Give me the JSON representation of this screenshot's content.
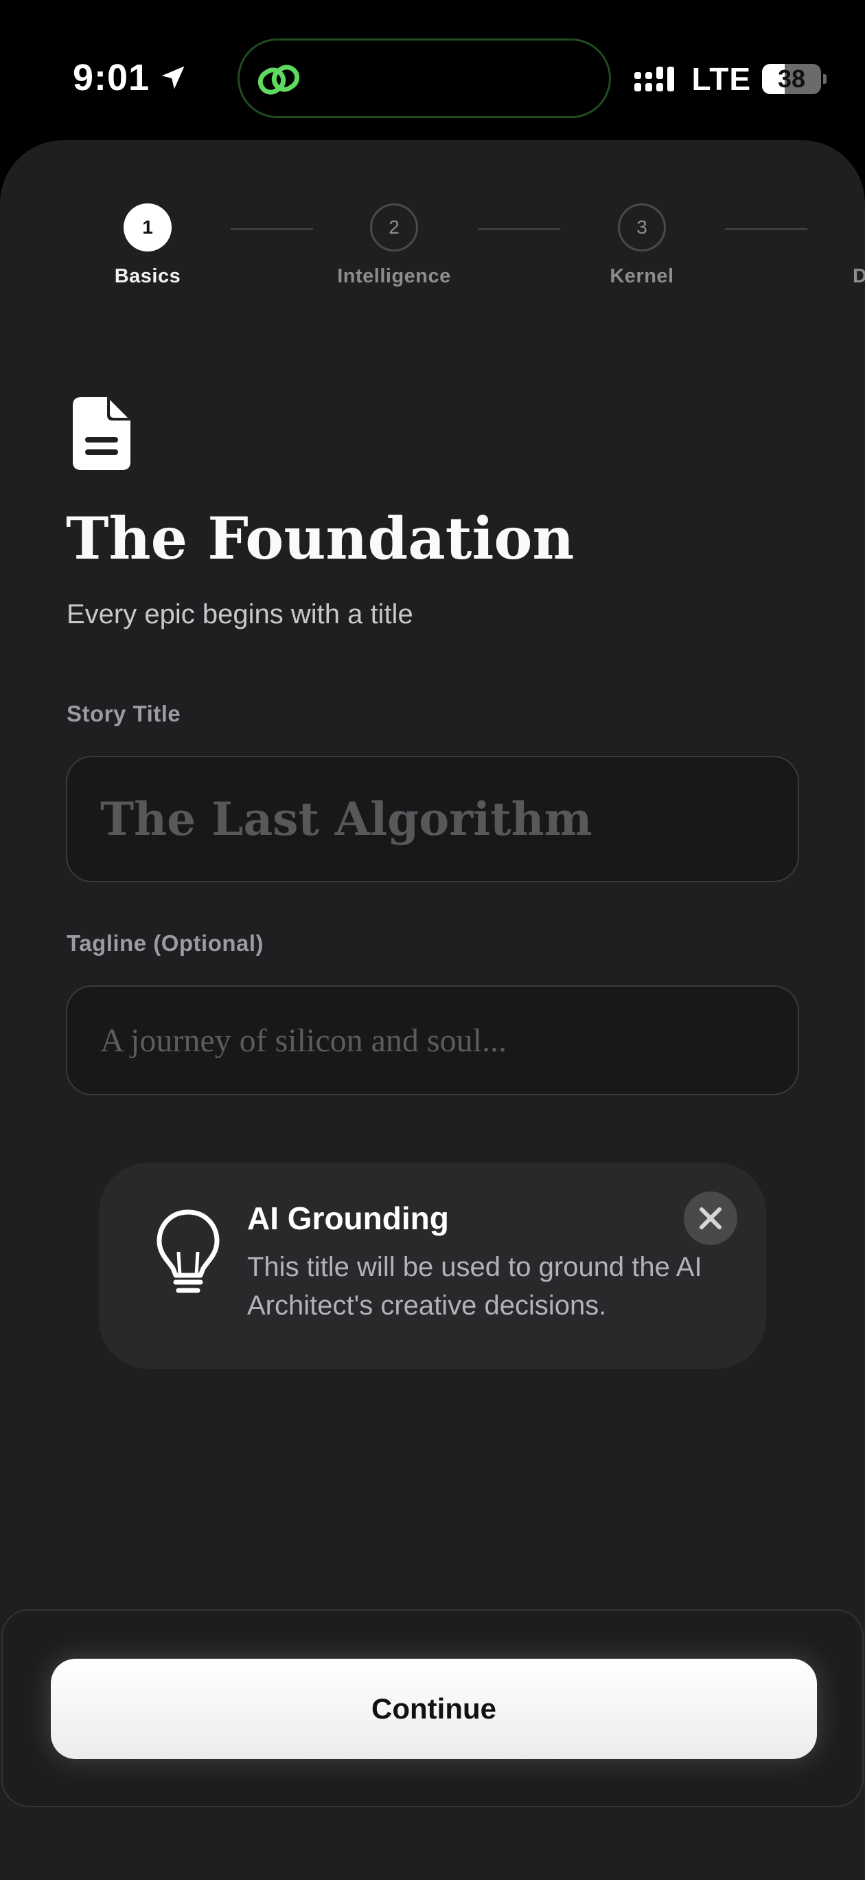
{
  "status_bar": {
    "time": "9:01",
    "network": "LTE",
    "battery_percent": "38",
    "icons": [
      "location-arrow-icon",
      "link-icon",
      "signal-icon",
      "battery-icon"
    ],
    "island_accent_color": "#5fd95f"
  },
  "stepper": {
    "steps": [
      {
        "number": "1",
        "label": "Basics",
        "state": "active"
      },
      {
        "number": "2",
        "label": "Intelligence",
        "state": "inactive"
      },
      {
        "number": "3",
        "label": "Kernel",
        "state": "inactive"
      },
      {
        "number": "",
        "label": "D",
        "state": "inactive"
      }
    ]
  },
  "header": {
    "icon": "document-icon",
    "title": "The Foundation",
    "subtitle": "Every epic begins with a title"
  },
  "form": {
    "story_title": {
      "label": "Story Title",
      "value": "",
      "placeholder": "The Last Algorithm"
    },
    "tagline": {
      "label": "Tagline (Optional)",
      "value": "",
      "placeholder": "A journey of silicon and soul..."
    }
  },
  "tip": {
    "icon": "lightbulb-icon",
    "title": "AI Grounding",
    "body": "This title will be used to ground the AI Architect's creative decisions.",
    "close_icon": "close-icon"
  },
  "footer": {
    "continue_label": "Continue"
  }
}
